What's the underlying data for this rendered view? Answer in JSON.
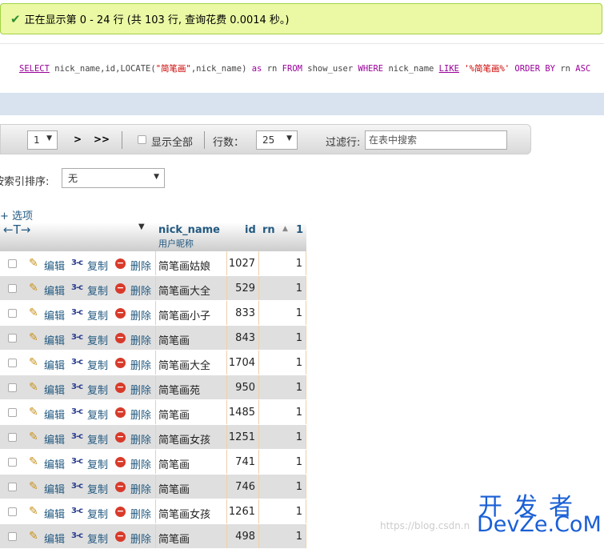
{
  "status": {
    "message": "正在显示第 0 - 24 行 (共 103 行, 查询花费 0.0014 秒。)"
  },
  "sql": {
    "tokens": [
      {
        "t": "SELECT",
        "c": "kw-u"
      },
      {
        "t": " nick_name,id,LOCATE(",
        "c": "plain"
      },
      {
        "t": "\"简笔画\"",
        "c": "str"
      },
      {
        "t": ",nick_name) ",
        "c": "plain"
      },
      {
        "t": "as",
        "c": "kw"
      },
      {
        "t": " rn ",
        "c": "plain"
      },
      {
        "t": "FROM",
        "c": "kw"
      },
      {
        "t": " show_user ",
        "c": "plain"
      },
      {
        "t": "WHERE",
        "c": "kw"
      },
      {
        "t": " nick_name ",
        "c": "plain"
      },
      {
        "t": "LIKE",
        "c": "kw-u"
      },
      {
        "t": " ",
        "c": "plain"
      },
      {
        "t": "'%简笔画%'",
        "c": "str"
      },
      {
        "t": " ",
        "c": "plain"
      },
      {
        "t": "ORDER BY",
        "c": "kw"
      },
      {
        "t": " rn ",
        "c": "plain"
      },
      {
        "t": "ASC",
        "c": "kw"
      }
    ]
  },
  "nav": {
    "page": "1",
    "next": ">",
    "last": ">>",
    "show_all": "显示全部",
    "rows_label": "行数：",
    "rows_value": "25",
    "filter_label": "过滤行:",
    "filter_placeholder": "在表中搜索"
  },
  "sort": {
    "label": "按索引排序:",
    "value": "无"
  },
  "options": {
    "label": "+ 选项"
  },
  "table": {
    "arrows": "←T→",
    "headers": {
      "nick_name": "nick_name",
      "nick_name_comment": "用户昵称",
      "id": "id",
      "rn": "rn",
      "sort_index": "1"
    },
    "actions": {
      "edit": "编辑",
      "copy": "复制",
      "delete": "删除"
    },
    "rows": [
      {
        "nick_name": "简笔画姑娘",
        "id": "1027",
        "rn": "1"
      },
      {
        "nick_name": "简笔画大全",
        "id": "529",
        "rn": "1"
      },
      {
        "nick_name": "简笔画小子",
        "id": "833",
        "rn": "1"
      },
      {
        "nick_name": "简笔画",
        "id": "843",
        "rn": "1"
      },
      {
        "nick_name": "简笔画大全",
        "id": "1704",
        "rn": "1"
      },
      {
        "nick_name": "简笔画苑",
        "id": "950",
        "rn": "1"
      },
      {
        "nick_name": "简笔画",
        "id": "1485",
        "rn": "1"
      },
      {
        "nick_name": "简笔画女孩",
        "id": "1251",
        "rn": "1"
      },
      {
        "nick_name": "简笔画",
        "id": "741",
        "rn": "1"
      },
      {
        "nick_name": "简笔画",
        "id": "746",
        "rn": "1"
      },
      {
        "nick_name": "简笔画女孩",
        "id": "1261",
        "rn": "1"
      },
      {
        "nick_name": "简笔画",
        "id": "498",
        "rn": "1"
      }
    ]
  },
  "watermark": {
    "url": "https://blog.csdn.n",
    "brand_top": "开发者",
    "brand_bottom": "DevZe.CoM"
  }
}
